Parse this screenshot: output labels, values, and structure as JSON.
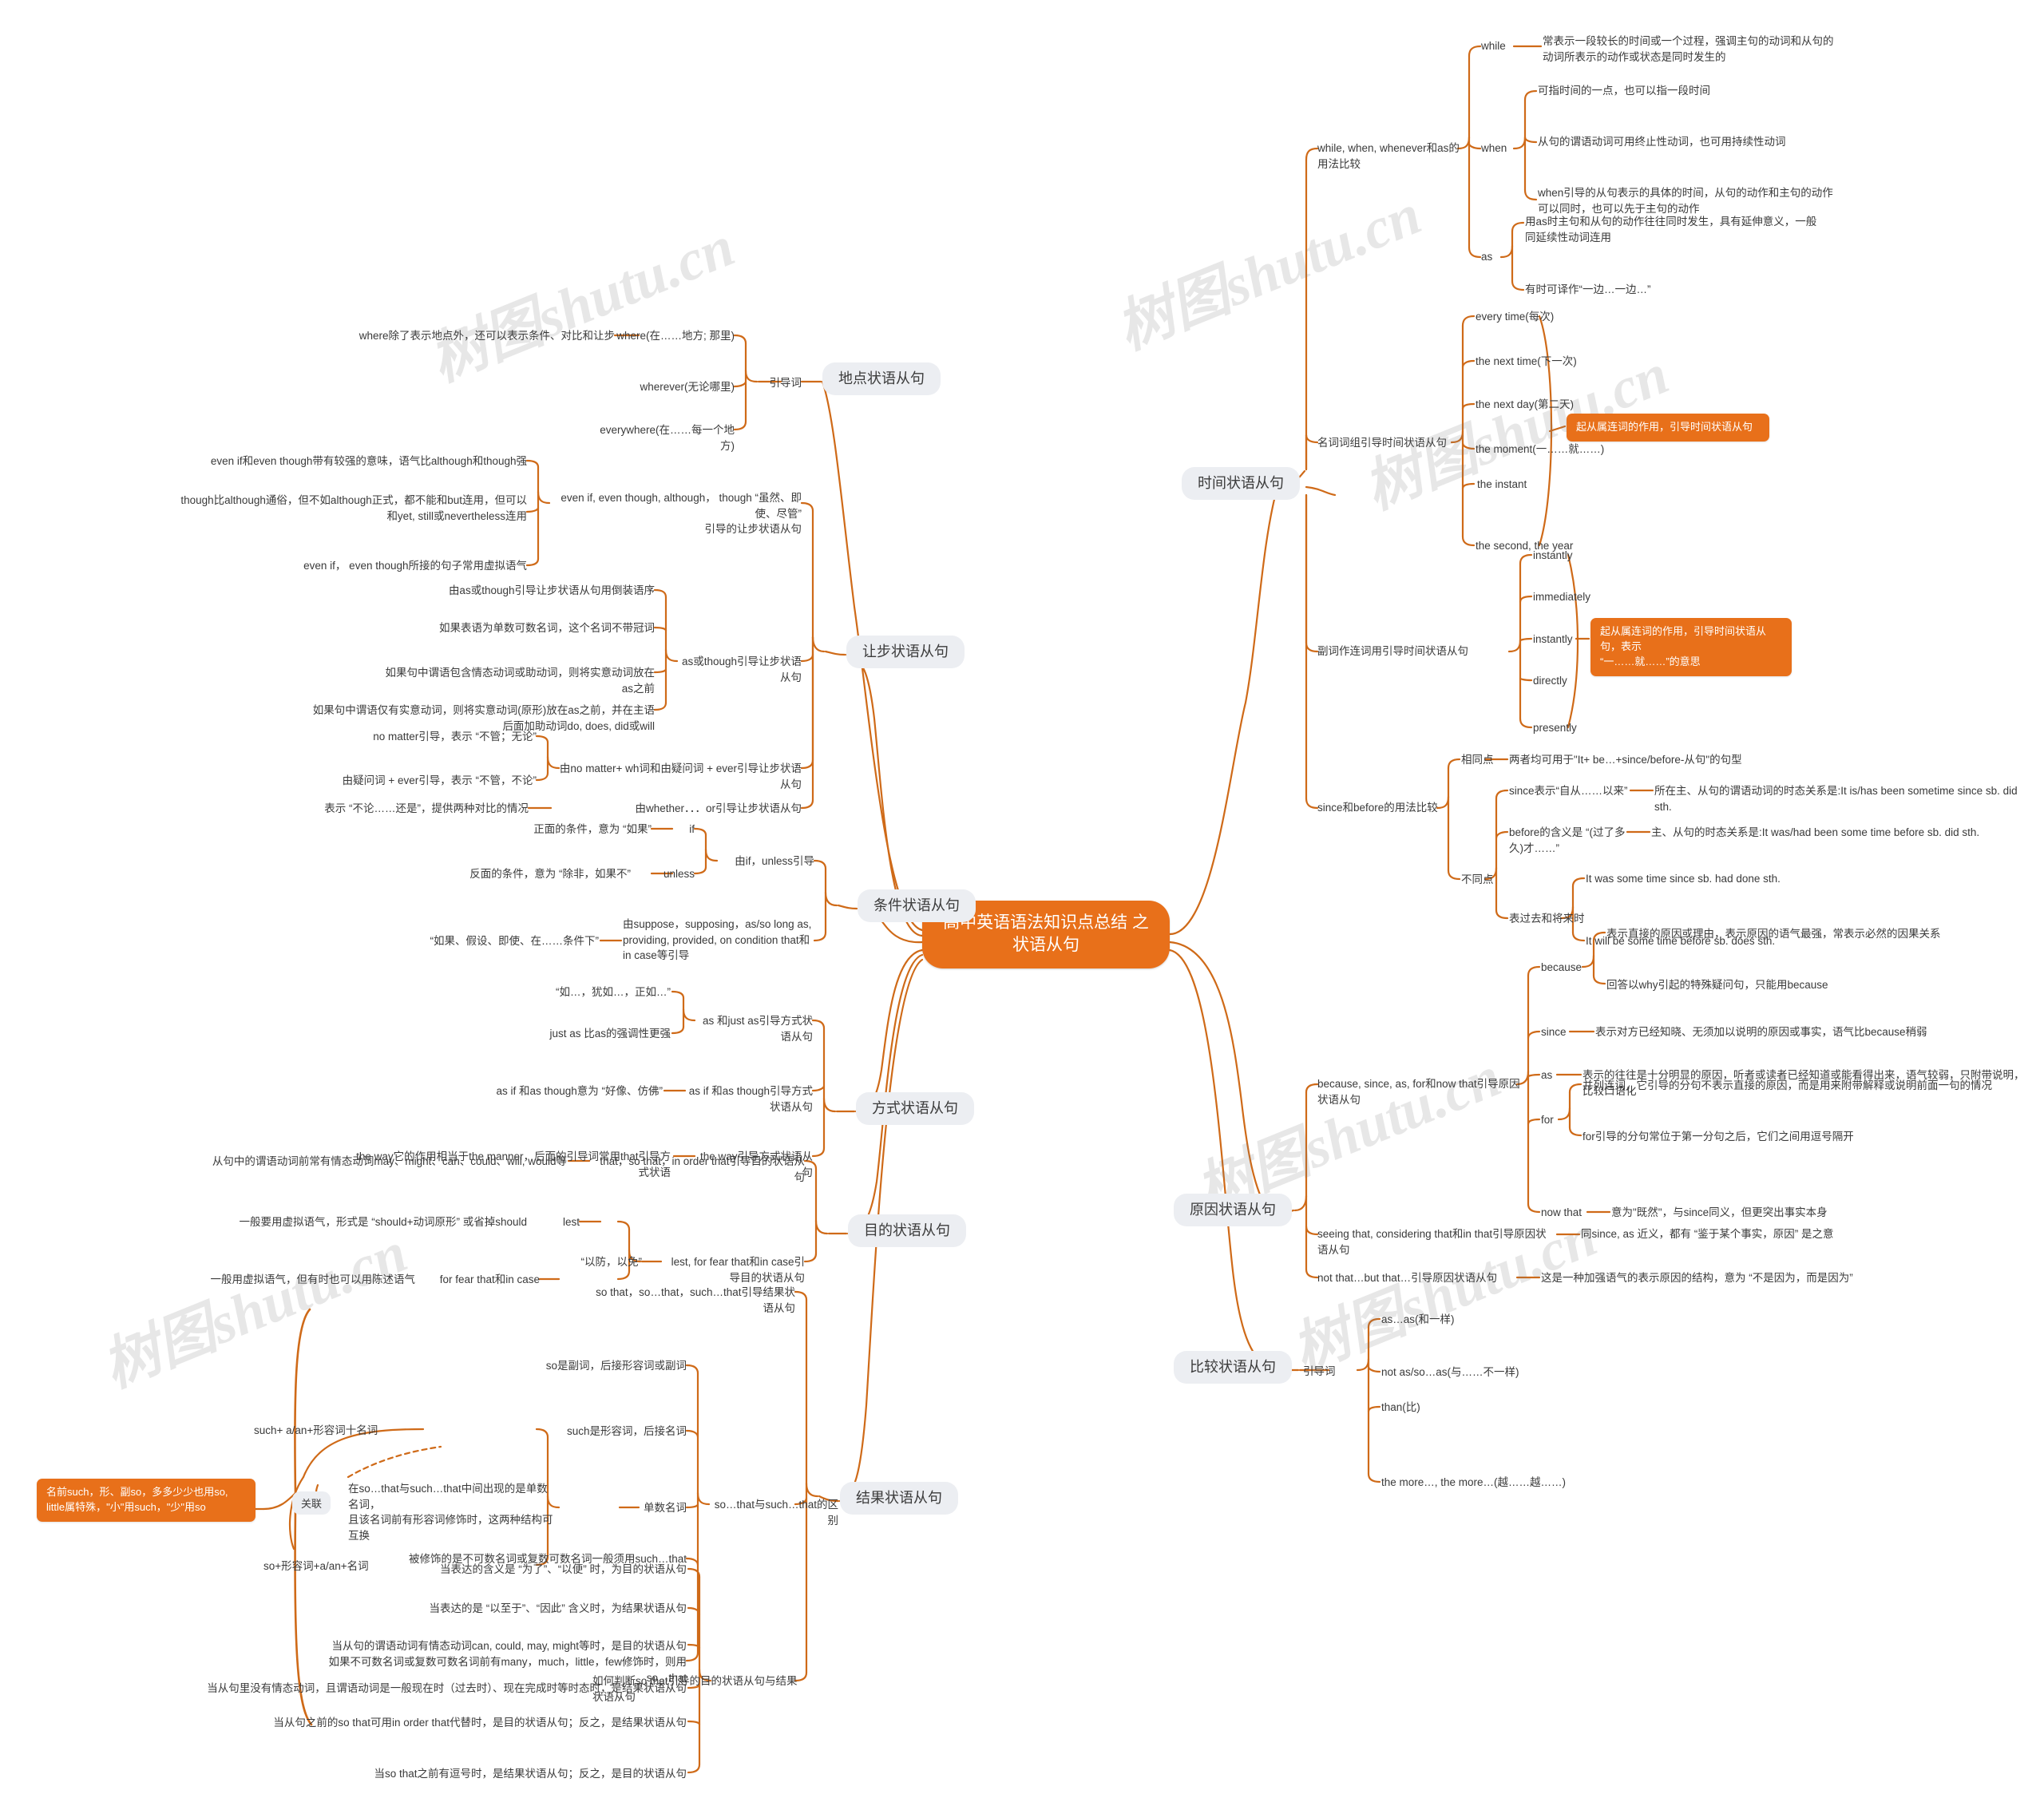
{
  "root": {
    "title": "高中英语语法知识点总结\n之状语从句"
  },
  "colors": {
    "accent": "#e8701a",
    "pill_bg": "#eceef2",
    "text": "#3a3a3a",
    "line": "#cf6a18"
  },
  "watermark": {
    "text": "树图shutu.cn"
  },
  "branches": {
    "time": {
      "label": "时间状语从句",
      "groups": [
        {
          "label": "while, when, whenever和as的用法比较",
          "children": [
            {
              "label": "while",
              "notes": [
                "常表示一段较长的时间或一个过程，强调主句的动词和从句的动词所表示的动作或状态是同时发生的"
              ]
            },
            {
              "label": "when",
              "notes": [
                "可指时间的一点，也可以指一段时间",
                "从句的谓语动词可用终止性动词，也可用持续性动词",
                "when引导的从句表示的具体的时间，从句的动作和主句的动作可以同时，也可以先于主句的动作"
              ]
            },
            {
              "label": "as",
              "notes": [
                "用as时主句和从句的动作往往同时发生，具有延伸意义，一般同延续性动词连用",
                "有时可译作“一边…一边…”"
              ]
            }
          ]
        },
        {
          "label": "名词词组引导时间状语从句",
          "items": [
            "every time(每次)",
            "the next time(下一次)",
            "the next day(第二天)",
            "the moment(一……就……)",
            "the instant",
            "the second, the year"
          ],
          "callout": "起从属连词的作用，引导时间状语从句"
        },
        {
          "label": "副词作连词用引导时间状语从句",
          "items": [
            "instantly",
            "immediately",
            "instantly",
            "directly",
            "presently"
          ],
          "callout": "起从属连词的作用，引导时间状语从句，表示\n“一……就……”的意思"
        },
        {
          "label": "since和before的用法比较",
          "same_label": "相同点",
          "same_note": "两者均可用于\"It+ be…+since/before-从句\"的句型",
          "diff_label": "不同点",
          "diffs": [
            {
              "left": "since表示“自从……以来”",
              "right": "所在主、从句的谓语动词的时态关系是:It is/has been sometime since sb. did sth."
            },
            {
              "left": "before的含义是 “(过了多久)才……”",
              "right": "主、从句的时态关系是:It was/had been some time before sb. did sth."
            }
          ],
          "tense_label": "表过去和将来时",
          "tense_items": [
            "It was some time since sb. had done sth.",
            "It will be some time before sb. does sth."
          ]
        }
      ]
    },
    "reason": {
      "label": "原因状语从句",
      "groups": [
        {
          "label": "because, since, as, for和now that引导原因状语从句",
          "children": [
            {
              "label": "because",
              "notes": [
                "表示直接的原因或理由，表示原因的语气最强，常表示必然的因果关系",
                "回答以why引起的特殊疑问句，只能用because"
              ]
            },
            {
              "label": "since",
              "notes": [
                "表示对方已经知晓、无须加以说明的原因或事实，语气比because稍弱"
              ]
            },
            {
              "label": "as",
              "notes": [
                "表示的往往是十分明显的原因，听者或读者已经知道或能看得出来，语气较弱，只附带说明，比较口语化"
              ]
            },
            {
              "label": "for",
              "notes": [
                "并列连词，它引导的分句不表示直接的原因，而是用来附带解释或说明前面一句的情况",
                "for引导的分句常位于第一分句之后，它们之间用逗号隔开"
              ]
            },
            {
              "label": "now that",
              "notes": [
                "意为\"既然\"，与since同义，但更突出事实本身"
              ]
            }
          ]
        },
        {
          "label": "seeing that, considering that和in that引导原因状语从句",
          "note": "同since, as 近义，都有 “鉴于某个事实，原因” 是之意"
        },
        {
          "label": "not that…but that…引导原因状语从句",
          "note": "这是一种加强语气的表示原因的结构，意为 “不是因为，而是因为”"
        }
      ]
    },
    "comparison": {
      "label": "比较状语从句",
      "lead_label": "引导词",
      "items": [
        "as…as(和一样)",
        "not as/so…as(与……不一样)",
        "than(比)",
        "the more…, the more…(越……越……)"
      ]
    },
    "place": {
      "label": "地点状语从句",
      "lead_label": "引导词",
      "items": [
        {
          "label": "where(在……地方; 那里)",
          "note": "where除了表示地点外，还可以表示条件、对比和让步"
        },
        {
          "label": "wherever(无论哪里)",
          "note": ""
        },
        {
          "label": "everywhere(在……每一个地方)",
          "note": ""
        }
      ]
    },
    "concession": {
      "label": "让步状语从句",
      "groups": [
        {
          "label": "even if, even though, although， though “虽然、即使、尽管”\n引导的让步状语从句",
          "notes": [
            "even if和even though带有较强的意味，语气比although和though强",
            "though比although通俗，但不如although正式，都不能和but连用，但可以和yet, still或nevertheless连用",
            "even if， even though所接的句子常用虚拟语气"
          ]
        },
        {
          "label": "as或though引导让步状语从句",
          "notes": [
            "由as或though引导让步状语从句用倒装语序",
            "如果表语为单数可数名词，这个名词不带冠词",
            "如果句中谓语包含情态动词或助动词，则将实意动词放在as之前",
            "如果句中谓语仅有实意动词，则将实意动词(原形)放在as之前，并在主语后面加助动词do, does, did或will"
          ]
        },
        {
          "label": "由no matter+ wh词和由疑问词 + ever引导让步状语从句",
          "notes": [
            "no matter引导，表示 “不管；无论”",
            "由疑问词 + ever引导，表示 “不管，不论”"
          ]
        },
        {
          "label": "由whether．．．or引导让步状语从句",
          "notes": [
            "表示 “不论……还是”，提供两种对比的情况"
          ]
        }
      ]
    },
    "condition": {
      "label": "条件状语从句",
      "groups": [
        {
          "label": "由if，unless引导",
          "children": [
            {
              "label": "if",
              "note": "正面的条件，意为 “如果”"
            },
            {
              "label": "unless",
              "note": "反面的条件，意为 “除非，如果不”"
            }
          ]
        },
        {
          "label": "由suppose，supposing，as/so long as,\nproviding, provided, on condition that和\nin case等引导",
          "note": "“如果、假设、即使、在……条件下”"
        }
      ]
    },
    "manner": {
      "label": "方式状语从句",
      "groups": [
        {
          "label": "as 和just as引导方式状语从句",
          "notes": [
            "“如…，犹如…，正如…”",
            "just as 比as的强调性更强"
          ]
        },
        {
          "label": "as if 和as though引导方式状语从句",
          "notes": [
            "as if 和as though意为 “好像、仿佛”"
          ]
        },
        {
          "label": "the way引导方式状语从句",
          "notes": [
            "the way它的作用相当于the manner，后面的引导词常用that引导方式状语"
          ]
        }
      ]
    },
    "purpose": {
      "label": "目的状语从句",
      "groups": [
        {
          "label": "that，so that，in order that引导目的状语从句",
          "notes": [
            "从句中的谓语动词前常有情态动词may、might、can、could、will, would等"
          ]
        },
        {
          "label": "lest, for fear that和in case引导目的状语从句",
          "mid": "“以防，以免”",
          "children": [
            {
              "label": "lest",
              "note": "一般要用虚拟语气，形式是 “should+动词原形” 或省掉should"
            },
            {
              "label": "for fear that和in case",
              "note": "一般用虚拟语气，但有时也可以用陈述语气"
            }
          ]
        }
      ]
    },
    "result": {
      "label": "结果状语从句",
      "groups": [
        {
          "label": "so that，so…that，such…that引导结果状语从句"
        },
        {
          "label": "so…that与such…that的区别",
          "children": [
            {
              "label": "so是副词，后接形容词或副词"
            },
            {
              "label": "such是形容词，后接名词"
            },
            {
              "label": "单数名词",
              "note": "在so…that与such…that中间出现的是单数名词，\n且该名词前有形容词修饰时，这两种结构可互换",
              "forms": [
                "such+ a/an+形容词十名词",
                "so+形容词+a/an+名词"
              ],
              "link_label": "关联",
              "callout": "名前such，形、副so，多多少少也用so,\nlittle属特殊，\"小\"用such，\"少\"用so"
            },
            {
              "label": "被修饰的是不可数名词或复数可数名词一般须用such…that"
            },
            {
              "label": "如果不可数名词或复数可数名词前有many，much，little，few修饰时，则用so…that"
            }
          ]
        },
        {
          "label": "如何判断so that引导的目的状语从句与结果状语从句",
          "notes": [
            "当表达的含义是 “为了”、“以便” 时，为目的状语从句",
            "当表达的是 “以至于”、“因此” 含义时，为结果状语从句",
            "当从句的谓语动词有情态动词can, could, may, might等时，是目的状语从句",
            "当从句里没有情态动词，且谓语动词是一般现在时（过去时）、现在完成时等时态时，是结果状语从句",
            "当从句之前的so that可用in order that代替时，是目的状语从句；反之，是结果状语从句",
            "当so that之前有逗号时，是结果状语从句；反之，是目的状语从句"
          ]
        }
      ]
    }
  }
}
